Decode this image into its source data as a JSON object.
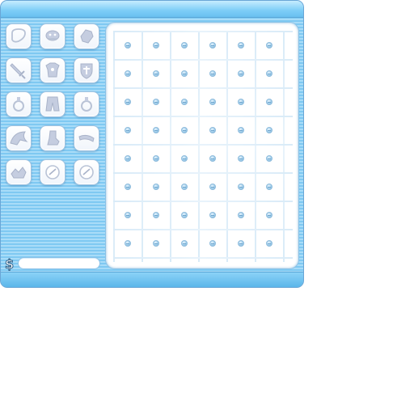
{
  "window": {
    "title": ""
  },
  "equipment": {
    "slots": [
      {
        "name": "ring-slot-top",
        "icon": "necklace-icon"
      },
      {
        "name": "helmet-slot",
        "icon": "helmet-icon"
      },
      {
        "name": "glove-slot",
        "icon": "glove-icon"
      },
      {
        "name": "weapon-slot",
        "icon": "sword-icon"
      },
      {
        "name": "armor-slot",
        "icon": "armor-icon"
      },
      {
        "name": "shield-slot",
        "icon": "shield-icon"
      },
      {
        "name": "ring-slot-left",
        "icon": "ring-icon"
      },
      {
        "name": "pants-slot",
        "icon": "pants-icon"
      },
      {
        "name": "ring-slot-right",
        "icon": "ring-icon"
      },
      {
        "name": "wings-slot",
        "icon": "wings-icon"
      },
      {
        "name": "boots-slot",
        "icon": "boots-icon"
      },
      {
        "name": "belt-slot",
        "icon": "belt-icon"
      },
      {
        "name": "pet-slot",
        "icon": "pet-icon"
      },
      {
        "name": "orb-slot-left",
        "icon": "orb-icon"
      },
      {
        "name": "orb-slot-right",
        "icon": "orb-icon"
      }
    ]
  },
  "inventory": {
    "rows": 8,
    "cols": 6
  },
  "money": {
    "icon": "money-icon",
    "value": ""
  }
}
